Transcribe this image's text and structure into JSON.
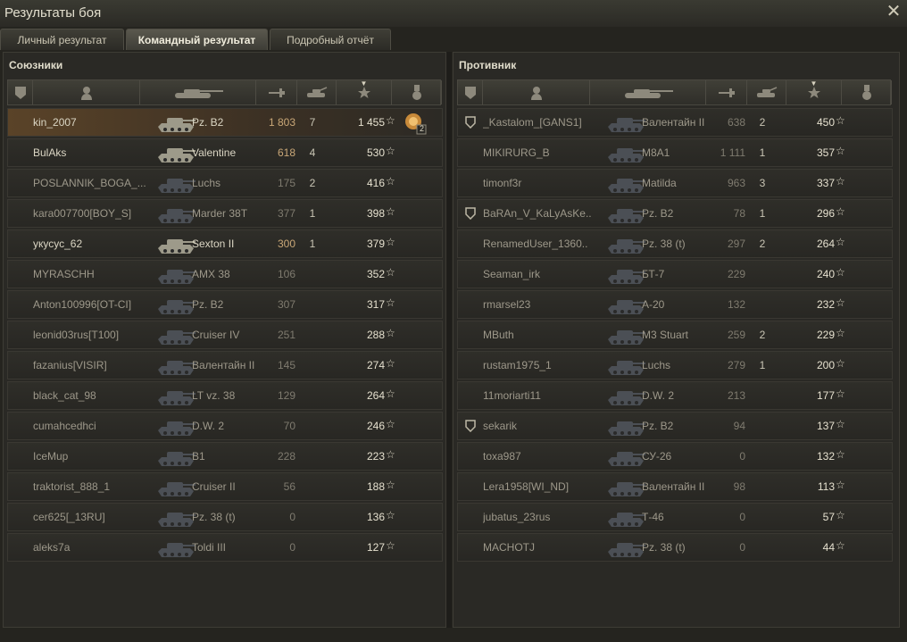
{
  "window": {
    "title": "Результаты боя"
  },
  "tabs": [
    {
      "label": "Личный результат",
      "active": false
    },
    {
      "label": "Командный результат",
      "active": true
    },
    {
      "label": "Подробный отчёт",
      "active": false
    }
  ],
  "allies": {
    "title": "Союзники",
    "rows": [
      {
        "player": "kin_2007",
        "tank": "Pz. B2",
        "damage": "1 803",
        "kills": "7",
        "xp": "1 455",
        "alive": true,
        "me": true,
        "medal": "2"
      },
      {
        "player": "BulAks",
        "tank": "Valentine",
        "damage": "618",
        "kills": "4",
        "xp": "530",
        "alive": true
      },
      {
        "player": "POSLANNIK_BOGA_...",
        "tank": "Luchs",
        "damage": "175",
        "kills": "2",
        "xp": "416",
        "alive": false
      },
      {
        "player": "kara007700[BOY_S]",
        "tank": "Marder 38T",
        "damage": "377",
        "kills": "1",
        "xp": "398",
        "alive": false
      },
      {
        "player": "укусус_62",
        "tank": "Sexton II",
        "damage": "300",
        "kills": "1",
        "xp": "379",
        "alive": true
      },
      {
        "player": "MYRASCHH",
        "tank": "AMX 38",
        "damage": "106",
        "kills": "",
        "xp": "352",
        "alive": false
      },
      {
        "player": "Anton100996[OT-CI]",
        "tank": "Pz. B2",
        "damage": "307",
        "kills": "",
        "xp": "317",
        "alive": false
      },
      {
        "player": "leonid03rus[T100]",
        "tank": "Cruiser IV",
        "damage": "251",
        "kills": "",
        "xp": "288",
        "alive": false
      },
      {
        "player": "fazanius[VISIR]",
        "tank": "Валентайн II",
        "damage": "145",
        "kills": "",
        "xp": "274",
        "alive": false
      },
      {
        "player": "black_cat_98",
        "tank": "LT vz. 38",
        "damage": "129",
        "kills": "",
        "xp": "264",
        "alive": false
      },
      {
        "player": "cumahcedhci",
        "tank": "D.W. 2",
        "damage": "70",
        "kills": "",
        "xp": "246",
        "alive": false
      },
      {
        "player": "IceMup",
        "tank": "B1",
        "damage": "228",
        "kills": "",
        "xp": "223",
        "alive": false
      },
      {
        "player": "traktorist_888_1",
        "tank": "Cruiser II",
        "damage": "56",
        "kills": "",
        "xp": "188",
        "alive": false
      },
      {
        "player": "cer625[_13RU]",
        "tank": "Pz. 38 (t)",
        "damage": "0",
        "kills": "",
        "xp": "136",
        "alive": false
      },
      {
        "player": "aleks7a",
        "tank": "Toldi III",
        "damage": "0",
        "kills": "",
        "xp": "127",
        "alive": false
      }
    ]
  },
  "enemies": {
    "title": "Противник",
    "rows": [
      {
        "player": "_Kastalom_[GANS1]",
        "tank": "Валентайн II",
        "damage": "638",
        "kills": "2",
        "xp": "450",
        "alive": false,
        "clan": true
      },
      {
        "player": "MIKIRURG_B",
        "tank": "M8A1",
        "damage": "1 111",
        "kills": "1",
        "xp": "357",
        "alive": false
      },
      {
        "player": "timonf3r",
        "tank": "Matilda",
        "damage": "963",
        "kills": "3",
        "xp": "337",
        "alive": false
      },
      {
        "player": "BaRAn_V_KaLyAsKe..",
        "tank": "Pz. B2",
        "damage": "78",
        "kills": "1",
        "xp": "296",
        "alive": false,
        "clan": true
      },
      {
        "player": "RenamedUser_1360..",
        "tank": "Pz. 38 (t)",
        "damage": "297",
        "kills": "2",
        "xp": "264",
        "alive": false
      },
      {
        "player": "Seaman_irk",
        "tank": "БТ-7",
        "damage": "229",
        "kills": "",
        "xp": "240",
        "alive": false
      },
      {
        "player": "rmarsel23",
        "tank": "A-20",
        "damage": "132",
        "kills": "",
        "xp": "232",
        "alive": false
      },
      {
        "player": "MButh",
        "tank": "M3 Stuart",
        "damage": "259",
        "kills": "2",
        "xp": "229",
        "alive": false
      },
      {
        "player": "rustam1975_1",
        "tank": "Luchs",
        "damage": "279",
        "kills": "1",
        "xp": "200",
        "alive": false
      },
      {
        "player": "11moriarti11",
        "tank": "D.W. 2",
        "damage": "213",
        "kills": "",
        "xp": "177",
        "alive": false
      },
      {
        "player": "sekarik",
        "tank": "Pz. B2",
        "damage": "94",
        "kills": "",
        "xp": "137",
        "alive": false,
        "clan": true
      },
      {
        "player": "toxa987",
        "tank": "СУ-26",
        "damage": "0",
        "kills": "",
        "xp": "132",
        "alive": false
      },
      {
        "player": "Lera1958[WI_ND]",
        "tank": "Валентайн II",
        "damage": "98",
        "kills": "",
        "xp": "113",
        "alive": false
      },
      {
        "player": "jubatus_23rus",
        "tank": "Т-46",
        "damage": "0",
        "kills": "",
        "xp": "57",
        "alive": false
      },
      {
        "player": "MACHOTJ",
        "tank": "Pz. 38 (t)",
        "damage": "0",
        "kills": "",
        "xp": "44",
        "alive": false
      }
    ]
  },
  "header_icons": [
    "squad-icon",
    "player-icon",
    "tank-icon",
    "damage-icon",
    "kills-icon",
    "xp-star-icon",
    "medal-icon"
  ],
  "star_glyph": "☆",
  "close_glyph": "✕",
  "sort_glyph": "▼"
}
